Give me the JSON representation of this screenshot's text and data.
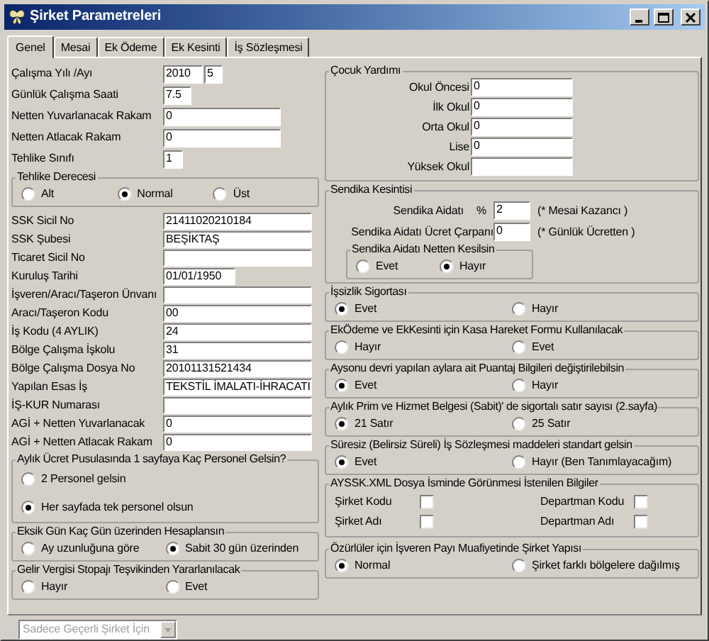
{
  "window": {
    "title": "Şirket Parametreleri"
  },
  "tabs": [
    {
      "label": "Genel",
      "selected": true
    },
    {
      "label": "Mesai",
      "selected": false
    },
    {
      "label": "Ek Ödeme",
      "selected": false
    },
    {
      "label": "Ek Kesinti",
      "selected": false
    },
    {
      "label": "İş Sözleşmesi",
      "selected": false
    }
  ],
  "top_fields": [
    {
      "label": "Çalışma Yılı /Ayı",
      "inputs": [
        {
          "kind": "year",
          "value": "2010"
        },
        {
          "kind": "month",
          "value": "5"
        }
      ]
    },
    {
      "label": "Günlük Çalışma Saati",
      "inputs": [
        {
          "kind": "short",
          "value": "7.5"
        }
      ]
    },
    {
      "label": "Netten Yuvarlanacak Rakam",
      "inputs": [
        {
          "kind": "medium",
          "value": "0"
        }
      ]
    },
    {
      "label": "Netten Atlacak Rakam",
      "inputs": [
        {
          "kind": "medium",
          "value": "0"
        }
      ]
    },
    {
      "label": "Tehlike Sınıfı",
      "inputs": [
        {
          "kind": "tiny",
          "value": "1"
        }
      ]
    }
  ],
  "hazard_group": {
    "title": "Tehlike Derecesi",
    "kind": "horizontal",
    "options": [
      {
        "label": "Alt",
        "selected": false
      },
      {
        "label": "Normal",
        "selected": true
      },
      {
        "label": "Üst",
        "selected": false
      }
    ]
  },
  "company_fields": [
    {
      "label": "SSK Sicil No",
      "kind": "long",
      "value": "21411020210184"
    },
    {
      "label": "SSK Şubesi",
      "kind": "long",
      "value": "BEŞİKTAŞ"
    },
    {
      "label": "Ticaret Sicil No",
      "kind": "long"
    },
    {
      "label": "Kuruluş Tarihi",
      "kind": "date",
      "value": "01/01/1950"
    },
    {
      "label": "İşveren/Aracı/Taşeron Ünvanı",
      "kind": "long"
    },
    {
      "label": "Aracı/Taşeron Kodu",
      "kind": "long",
      "value": "00"
    },
    {
      "label": "İş Kodu (4 AYLIK)",
      "kind": "long",
      "value": "24"
    },
    {
      "label": "Bölge Çalışma İşkolu",
      "kind": "long",
      "value": "31"
    },
    {
      "label": "Bölge Çalışma Dosya No",
      "kind": "long",
      "value": "20101131521434"
    },
    {
      "label": "Yapılan Esas İş",
      "kind": "long",
      "value": "TEKSTİL İMALATI-İHRACATI"
    },
    {
      "label": "İŞ-KUR Numarası",
      "kind": "long"
    },
    {
      "label": "AGİ + Netten Yuvarlanacak",
      "kind": "long",
      "value": "0"
    },
    {
      "label": "AGİ + Netten Atlacak Rakam",
      "kind": "long",
      "value": "0"
    }
  ],
  "left_groups": [
    {
      "title": "Aylık Ücret Pusulasında 1 sayfaya Kaç Personel Gelsin?",
      "kind": "vertical",
      "options": [
        {
          "label": "2 Personel gelsin",
          "selected": false
        },
        {
          "label": "Her sayfada tek personel olsun",
          "selected": true
        }
      ]
    },
    {
      "title": "Eksik Gün Kaç Gün üzerinden Hesaplansın",
      "kind": "horizontal",
      "options": [
        {
          "label": "Ay uzunluğuna göre",
          "selected": false
        },
        {
          "label": "Sabit 30 gün üzerinden",
          "selected": true
        }
      ]
    },
    {
      "title": "Gelir Vergisi Stopajı Teşvikinden Yararlanılacak",
      "kind": "horizontal",
      "options": [
        {
          "label": "Hayır",
          "selected": false
        },
        {
          "label": "Evet",
          "selected": false
        }
      ]
    }
  ],
  "child_allowance": {
    "title": "Çocuk Yardımı",
    "fields": [
      {
        "label": "Okul Öncesi",
        "value": "0"
      },
      {
        "label": "İlk Okul",
        "value": "0"
      },
      {
        "label": "Orta Okul",
        "value": "0"
      },
      {
        "label": "Lise",
        "value": "0"
      },
      {
        "label": "Yüksek Okul"
      }
    ]
  },
  "union": {
    "title": "Sendika Kesintisi",
    "rows": [
      {
        "label": "Sendika Aidatı",
        "symbol": "%",
        "value": "2",
        "note": "(* Mesai Kazancı )"
      },
      {
        "label": "Sendika Aidatı Ücret Çarpanı",
        "value": "0",
        "note": "(* Günlük Ücretten )"
      }
    ],
    "deduction": {
      "title": "Sendika Aidatı Netten Kesilsin",
      "kind": "horizontal",
      "options": [
        {
          "label": "Evet",
          "selected": false
        },
        {
          "label": "Hayır",
          "selected": true
        }
      ]
    }
  },
  "right_groups": [
    {
      "title": "İşsizlik Sigortası",
      "kind": "horizontal",
      "options": [
        {
          "label": "Evet",
          "selected": true
        },
        {
          "label": "Hayır",
          "selected": false
        }
      ]
    },
    {
      "title": "EkÖdeme ve EkKesinti için Kasa Hareket Formu Kullanılacak",
      "kind": "horizontal",
      "options": [
        {
          "label": "Hayır",
          "selected": false
        },
        {
          "label": "Evet",
          "selected": false
        }
      ]
    },
    {
      "title": "Aysonu devri yapılan aylara ait Puantaj Bilgileri değiştirilebilsin",
      "kind": "horizontal",
      "options": [
        {
          "label": "Evet",
          "selected": true
        },
        {
          "label": "Hayır",
          "selected": false
        }
      ]
    },
    {
      "title": "Aylık Prim ve Hizmet Belgesi (Sabit)' de sigortalı satır sayısı (2.sayfa)",
      "kind": "horizontal",
      "options": [
        {
          "label": "21 Satır",
          "selected": true
        },
        {
          "label": "25 Satır",
          "selected": false
        }
      ]
    },
    {
      "title": "Süresiz (Belirsiz Süreli) İş Sözleşmesi maddeleri standart gelsin",
      "kind": "horizontal",
      "options": [
        {
          "label": "Evet",
          "selected": true
        },
        {
          "label": "Hayır (Ben Tanımlayacağım)",
          "selected": false
        }
      ]
    }
  ],
  "xml_fields": {
    "title": "AYSSK.XML Dosya İsminde Görünmesi İstenilen Bilgiler",
    "checkboxes": [
      {
        "label": "Şirket Kodu",
        "checked": false
      },
      {
        "label": "Departman Kodu",
        "checked": false
      },
      {
        "label": "Şirket Adı",
        "checked": false
      },
      {
        "label": "Departman Adı",
        "checked": false
      }
    ]
  },
  "disabled_group": {
    "title": "Özürlüler için İşveren Payı Muafiyetinde Şirket Yapısı",
    "kind": "horizontal",
    "options": [
      {
        "label": "Normal",
        "selected": true
      },
      {
        "label": "Şirket farklı bölgelere dağılmış",
        "selected": false
      }
    ]
  },
  "scope_select": {
    "value": "Sadece Geçerli Şirket İçin",
    "disabled": true
  }
}
